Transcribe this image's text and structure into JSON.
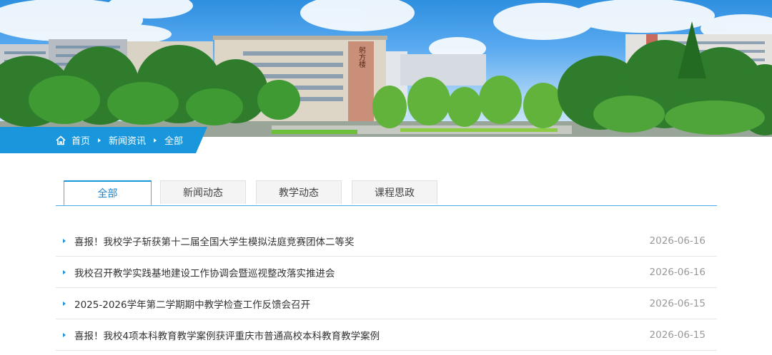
{
  "banner": {
    "building_sign": "躬方楼"
  },
  "breadcrumb": {
    "home": "首页",
    "news": "新闻资讯",
    "current": "全部"
  },
  "tabs": [
    {
      "label": "全部",
      "active": true
    },
    {
      "label": "新闻动态",
      "active": false
    },
    {
      "label": "教学动态",
      "active": false
    },
    {
      "label": "课程思政",
      "active": false
    }
  ],
  "news": [
    {
      "title": "喜报！我校学子斩获第十二届全国大学生模拟法庭竞赛团体二等奖",
      "date": "2026-06-16"
    },
    {
      "title": "我校召开教学实践基地建设工作协调会暨巡视整改落实推进会",
      "date": "2026-06-16"
    },
    {
      "title": "2025-2026学年第二学期期中教学检查工作反馈会召开",
      "date": "2026-06-15"
    },
    {
      "title": "喜报！我校4项本科教育教学案例获评重庆市普通高校本科教育教学案例",
      "date": "2026-06-15"
    }
  ],
  "colors": {
    "accent": "#1a97dc",
    "date": "#999999",
    "text": "#333333"
  }
}
